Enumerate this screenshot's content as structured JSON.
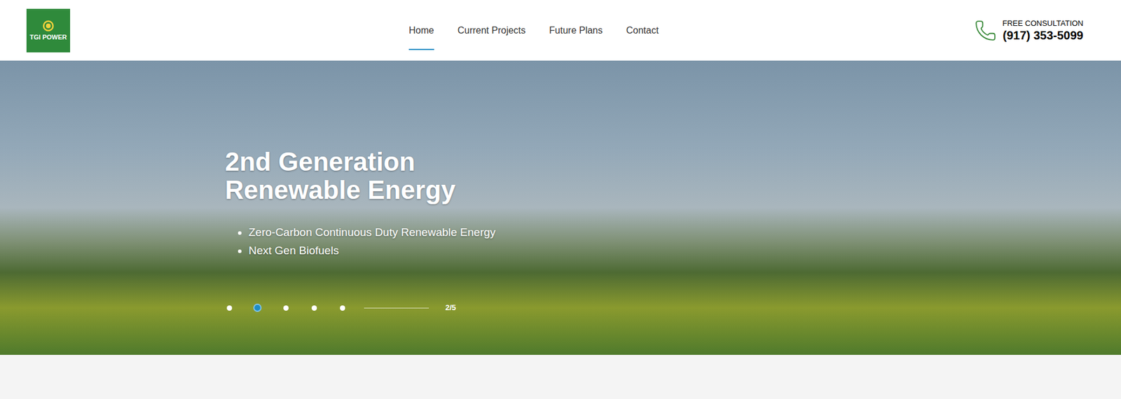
{
  "logo": {
    "text": "TGI POWER"
  },
  "nav": [
    {
      "label": "Home",
      "selected": true
    },
    {
      "label": "Current Projects",
      "selected": false
    },
    {
      "label": "Future Plans",
      "selected": false
    },
    {
      "label": "Contact",
      "selected": false
    }
  ],
  "contact": {
    "label": "FREE CONSULTATION",
    "phone": "(917) 353-5099"
  },
  "hero": {
    "title": "2nd Generation Renewable Energy",
    "bullets": [
      "Zero-Carbon Continuous Duty Renewable Energy",
      "Next Gen Biofuels"
    ]
  },
  "slider": {
    "dots": [
      {
        "selected": false
      },
      {
        "selected": true
      },
      {
        "selected": false
      },
      {
        "selected": false
      },
      {
        "selected": false
      }
    ],
    "counter": "2/5"
  }
}
